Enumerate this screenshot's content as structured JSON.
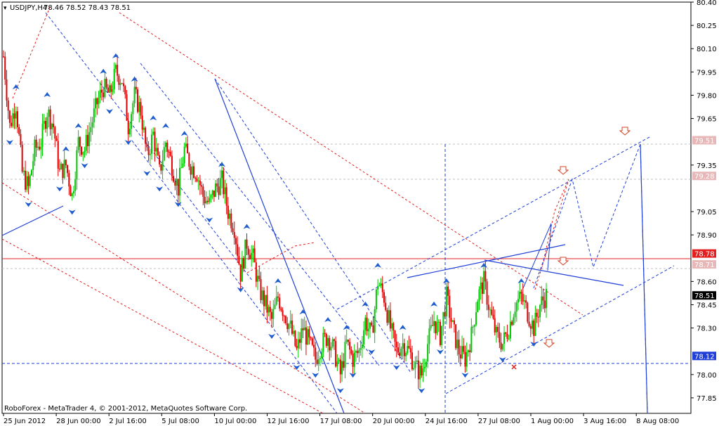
{
  "header": {
    "symbol_label": "USDJPY,H4",
    "quote": "78.46 78.52 78.43 78.51"
  },
  "footer": {
    "copyright": "RoboForex - MetaTrader 4, © 2001-2012, MetaQuotes Software Corp."
  },
  "colors": {
    "background": "#ffffff",
    "bull_candle": "#00c800",
    "bear_candle": "#e00000",
    "fractal_arrow": "#1e5ccf",
    "trend_blue": "#1f3fd8",
    "trend_red": "#e32020",
    "target_arrow": "#d84020",
    "price_badge": "#000000",
    "level_badge": "#e8b8b8",
    "level_blue_badge": "#1f3fd8"
  },
  "chart_data": {
    "type": "candlestick",
    "symbol": "USDJPY",
    "timeframe": "H4",
    "last_ohlc": {
      "open": 78.46,
      "high": 78.52,
      "low": 78.43,
      "close": 78.51
    },
    "ylim": [
      77.75,
      80.4
    ],
    "y_ticks": [
      "80.40",
      "80.25",
      "80.10",
      "79.95",
      "79.80",
      "79.65",
      "79.35",
      "79.05",
      "78.90",
      "78.60",
      "78.45",
      "78.30",
      "78.00",
      "77.85"
    ],
    "x_ticks": [
      "25 Jun 2012",
      "28 Jun 00:00",
      "2 Jul 16:00",
      "5 Jul 08:00",
      "10 Jul 00:00",
      "12 Jul 16:00",
      "17 Jul 08:00",
      "20 Jul 00:00",
      "24 Jul 16:00",
      "27 Jul 08:00",
      "1 Aug 00:00",
      "3 Aug 16:00",
      "8 Aug 08:00"
    ],
    "levels": [
      {
        "label": "79.51",
        "value": 79.51,
        "style": "dashed-grey"
      },
      {
        "label": "79.28",
        "value": 79.28,
        "style": "dashed-grey"
      },
      {
        "label": "78.78",
        "value": 78.78,
        "style": "solid-red"
      },
      {
        "label": "78.71",
        "value": 78.71,
        "style": "dashed-grey"
      },
      {
        "label": "78.51",
        "value": 78.51,
        "style": "current-price"
      },
      {
        "label": "78.12",
        "value": 78.12,
        "style": "dashed-blue"
      }
    ],
    "close_path": [
      [
        0,
        80.05
      ],
      [
        4,
        79.6
      ],
      [
        8,
        79.75
      ],
      [
        12,
        79.3
      ],
      [
        16,
        79.2
      ],
      [
        20,
        79.45
      ],
      [
        24,
        79.5
      ],
      [
        28,
        79.7
      ],
      [
        32,
        79.6
      ],
      [
        36,
        79.3
      ],
      [
        40,
        79.35
      ],
      [
        44,
        79.15
      ],
      [
        48,
        79.5
      ],
      [
        52,
        79.45
      ],
      [
        56,
        79.6
      ],
      [
        60,
        79.75
      ],
      [
        64,
        79.85
      ],
      [
        68,
        79.8
      ],
      [
        72,
        79.95
      ],
      [
        76,
        79.9
      ],
      [
        80,
        79.6
      ],
      [
        84,
        79.8
      ],
      [
        88,
        79.7
      ],
      [
        92,
        79.4
      ],
      [
        96,
        79.55
      ],
      [
        100,
        79.3
      ],
      [
        104,
        79.5
      ],
      [
        108,
        79.35
      ],
      [
        112,
        79.2
      ],
      [
        116,
        79.45
      ],
      [
        120,
        79.35
      ],
      [
        124,
        79.3
      ],
      [
        128,
        79.15
      ],
      [
        132,
        79.1
      ],
      [
        136,
        79.2
      ],
      [
        140,
        79.25
      ],
      [
        144,
        79.05
      ],
      [
        148,
        78.95
      ],
      [
        152,
        78.65
      ],
      [
        156,
        78.85
      ],
      [
        160,
        78.75
      ],
      [
        164,
        78.55
      ],
      [
        168,
        78.45
      ],
      [
        172,
        78.35
      ],
      [
        176,
        78.5
      ],
      [
        180,
        78.4
      ],
      [
        184,
        78.3
      ],
      [
        188,
        78.15
      ],
      [
        192,
        78.3
      ],
      [
        196,
        78.2
      ],
      [
        200,
        78.1
      ],
      [
        204,
        78.2
      ],
      [
        208,
        78.25
      ],
      [
        212,
        78.15
      ],
      [
        216,
        78.0
      ],
      [
        220,
        78.2
      ],
      [
        224,
        78.1
      ],
      [
        228,
        78.15
      ],
      [
        232,
        78.35
      ],
      [
        236,
        78.25
      ],
      [
        240,
        78.6
      ],
      [
        244,
        78.5
      ],
      [
        248,
        78.3
      ],
      [
        252,
        78.15
      ],
      [
        256,
        78.2
      ],
      [
        260,
        78.15
      ],
      [
        264,
        78.05
      ],
      [
        268,
        78.0
      ],
      [
        272,
        78.2
      ],
      [
        276,
        78.35
      ],
      [
        280,
        78.25
      ],
      [
        284,
        78.5
      ],
      [
        288,
        78.3
      ],
      [
        292,
        78.15
      ],
      [
        296,
        78.1
      ],
      [
        300,
        78.25
      ],
      [
        304,
        78.5
      ],
      [
        308,
        78.6
      ],
      [
        312,
        78.4
      ],
      [
        316,
        78.25
      ],
      [
        320,
        78.2
      ],
      [
        324,
        78.3
      ],
      [
        328,
        78.45
      ],
      [
        332,
        78.5
      ],
      [
        336,
        78.4
      ],
      [
        340,
        78.3
      ],
      [
        344,
        78.45
      ],
      [
        348,
        78.51
      ]
    ]
  }
}
